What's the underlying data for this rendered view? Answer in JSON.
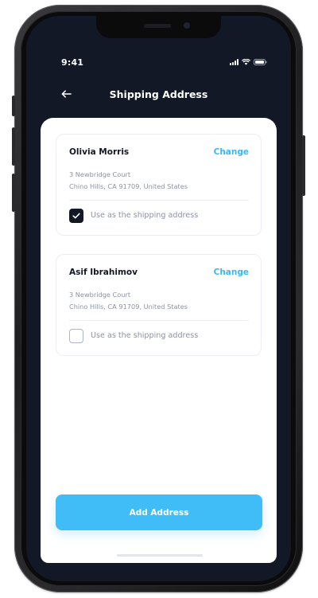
{
  "status_bar": {
    "time": "9:41"
  },
  "header": {
    "title": "Shipping Address",
    "back_icon": "arrow-left-icon"
  },
  "addresses": [
    {
      "name": "Olivia Morris",
      "change_label": "Change",
      "address_line1": "3 Newbridge Court",
      "address_line2": "Chino Hills, CA 91709, United States",
      "checkbox_label": "Use as the shipping address",
      "checked": true
    },
    {
      "name": "Asif Ibrahimov",
      "change_label": "Change",
      "address_line1": "3 Newbridge Court",
      "address_line2": "Chino Hills, CA 91709, United States",
      "checkbox_label": "Use as the shipping address",
      "checked": false
    }
  ],
  "footer": {
    "add_address_label": "Add Address"
  },
  "colors": {
    "accent": "#40bdf7",
    "dark": "#121826",
    "muted": "#8b93a3"
  }
}
